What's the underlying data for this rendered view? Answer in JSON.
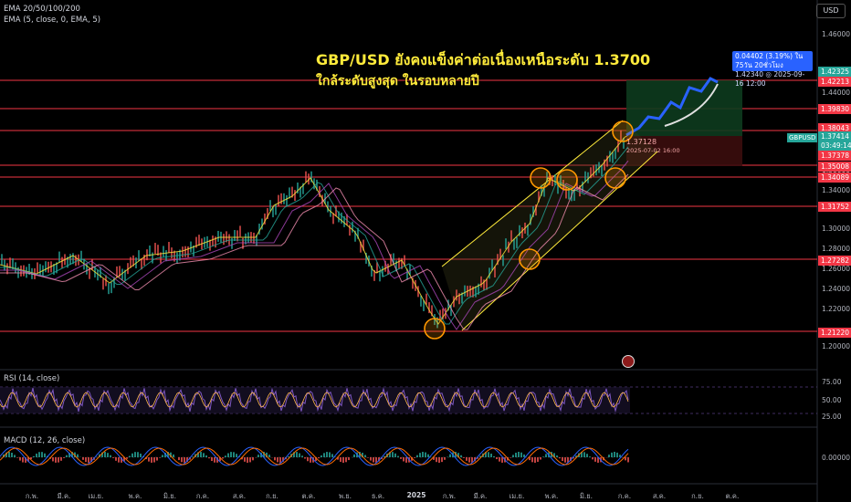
{
  "indicators": {
    "ema_ribbon": "EMA 20/50/100/200",
    "ema5": "EMA (5, close, 0, EMA, 5)",
    "rsi": "RSI (14, close)",
    "macd": "MACD (12, 26, close)"
  },
  "currency_button": "USD",
  "headline": {
    "line1": "GBP/USD ยังคงแข็งค่าต่อเนื่องเหนือระดับ 1.3700",
    "line2": "ใกล้ระดับสูงสุด ในรอบหลายปี"
  },
  "measure_box": {
    "line1": "0.04402 (3.19%) ใน 75วัน 20ชั่วโมง",
    "line2": "1.42340 ◎ 2025-09-16  12:00"
  },
  "symbol_tag": "GBPUSD",
  "entry_labels": {
    "price": "1.37128",
    "date": "2025-07-02 16:00"
  },
  "price_axis": [
    "1.46000",
    "1.44000",
    "1.42000",
    "1.40000",
    "1.38000",
    "1.36000",
    "1.34000",
    "1.32000",
    "1.30000",
    "1.28000",
    "1.26000",
    "1.24000",
    "1.22000",
    "1.20000"
  ],
  "price_tags": [
    {
      "text": "1.42325",
      "color": "#26a69a"
    },
    {
      "text": "1.42213",
      "color": "#f23645"
    },
    {
      "text": "1.39830",
      "color": "#f23645"
    },
    {
      "text": "1.38043",
      "color": "#f23645"
    },
    {
      "text": "1.37414",
      "color": "#26a69a"
    },
    {
      "text": "03:49:14",
      "color": "#26a69a"
    },
    {
      "text": "1.37378",
      "color": "#f23645"
    },
    {
      "text": "1.35008",
      "color": "#f23645"
    },
    {
      "text": "1.34089",
      "color": "#f23645"
    },
    {
      "text": "1.31752",
      "color": "#f23645"
    },
    {
      "text": "1.27282",
      "color": "#f23645"
    },
    {
      "text": "1.21220",
      "color": "#f23645"
    }
  ],
  "rsi_axis": [
    "75.00",
    "50.00",
    "25.00"
  ],
  "macd_axis": [
    "0.00000"
  ],
  "time_axis": [
    "ก.พ.",
    "มี.ค.",
    "เม.ย.",
    "พ.ค.",
    "มิ.ย.",
    "ก.ค.",
    "ส.ค.",
    "ก.ย.",
    "ต.ค.",
    "พ.ย.",
    "ธ.ค.",
    "2025",
    "ก.พ.",
    "มี.ค.",
    "เม.ย.",
    "พ.ค.",
    "มิ.ย.",
    "ก.ค.",
    "ส.ค.",
    "ก.ย.",
    "ต.ค."
  ],
  "colors": {
    "support": "#f23645",
    "channel": "#ffeb3b",
    "projection": "#2962ff",
    "circle": "#ff9800",
    "bg": "#000000"
  }
}
